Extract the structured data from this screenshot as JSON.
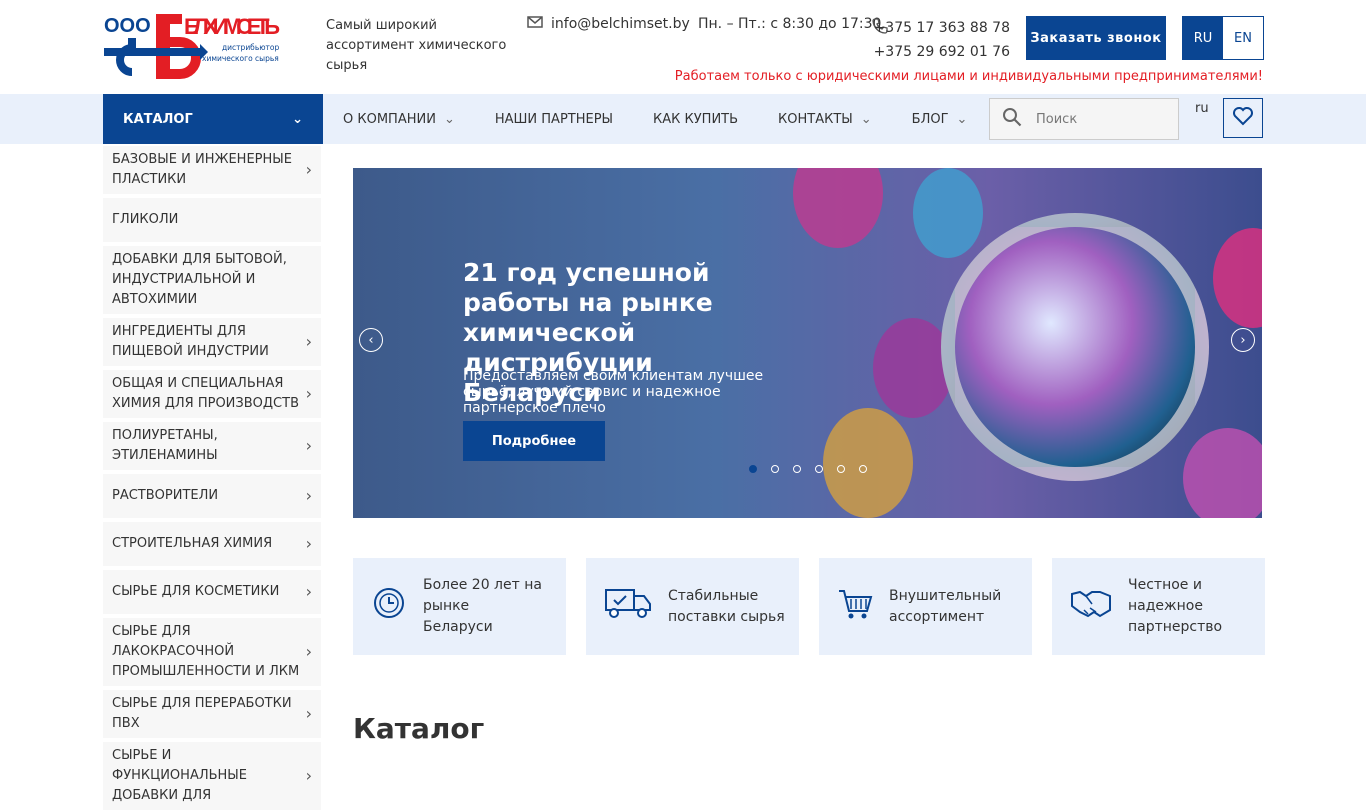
{
  "header": {
    "logo_text": "ООО БЕЛХИМСЕТЬ",
    "logo_sub": "дистрибьютор химического сырья",
    "tagline": "Самый широкий ассортимент химического сырья",
    "email": "info@belchimset.by",
    "hours": "Пн. – Пт.: с 8:30 до 17:30",
    "phone1": "+375 17 363 88 78",
    "phone2": "+375 29 692 01 76",
    "call_button": "Заказать звонок",
    "lang_ru": "RU",
    "lang_en": "EN",
    "notice": "Работаем только с юридическими лицами и индивидуальными предпринимателями!"
  },
  "nav": {
    "catalog": "КАТАЛОГ",
    "items": [
      "О КОМПАНИИ",
      "НАШИ ПАРТНЕРЫ",
      "КАК КУПИТЬ",
      "КОНТАКТЫ",
      "БЛОГ"
    ],
    "search_placeholder": "Поиск",
    "lang": "ru"
  },
  "sidebar": [
    "БАЗОВЫЕ И ИНЖЕНЕРНЫЕ ПЛАСТИКИ",
    "ГЛИКОЛИ",
    "ДОБАВКИ ДЛЯ БЫТОВОЙ, ИНДУСТРИАЛЬНОЙ И АВТОХИМИИ",
    "ИНГРЕДИЕНТЫ ДЛЯ ПИЩЕВОЙ ИНДУСТРИИ",
    "ОБЩАЯ И СПЕЦИАЛЬНАЯ ХИМИЯ ДЛЯ ПРОИЗВОДСТВ",
    "ПОЛИУРЕТАНЫ, ЭТИЛЕНАМИНЫ",
    "РАСТВОРИТЕЛИ",
    "СТРОИТЕЛЬНАЯ ХИМИЯ",
    "СЫРЬЕ ДЛЯ КОСМЕТИКИ",
    "СЫРЬЕ ДЛЯ ЛАКОКРАСОЧНОЙ ПРОМЫШЛЕННОСТИ И ЛКМ",
    "СЫРЬЕ ДЛЯ ПЕРЕРАБОТКИ ПВХ",
    "СЫРЬЕ И ФУНКЦИОНАЛЬНЫЕ ДОБАВКИ ДЛЯ"
  ],
  "slider": {
    "title": "21 год успешной работы на рынке химической дистрибуции Беларуси",
    "subtitle": "Предоставляем своим клиентам лучшее сырьё, лучший сервис и надежное партнерское плечо",
    "button": "Подробнее",
    "slide_count": 6,
    "active_slide": 1
  },
  "features": [
    "Более 20 лет на рынке Беларуси",
    "Стабильные поставки сырья",
    "Внушительный ассортимент",
    "Честное и надежное партнерство"
  ],
  "catalog_heading": "Каталог",
  "colors": {
    "brand": "#0a4592",
    "red": "#e31e24",
    "nav_bg": "#e9f0fb"
  }
}
